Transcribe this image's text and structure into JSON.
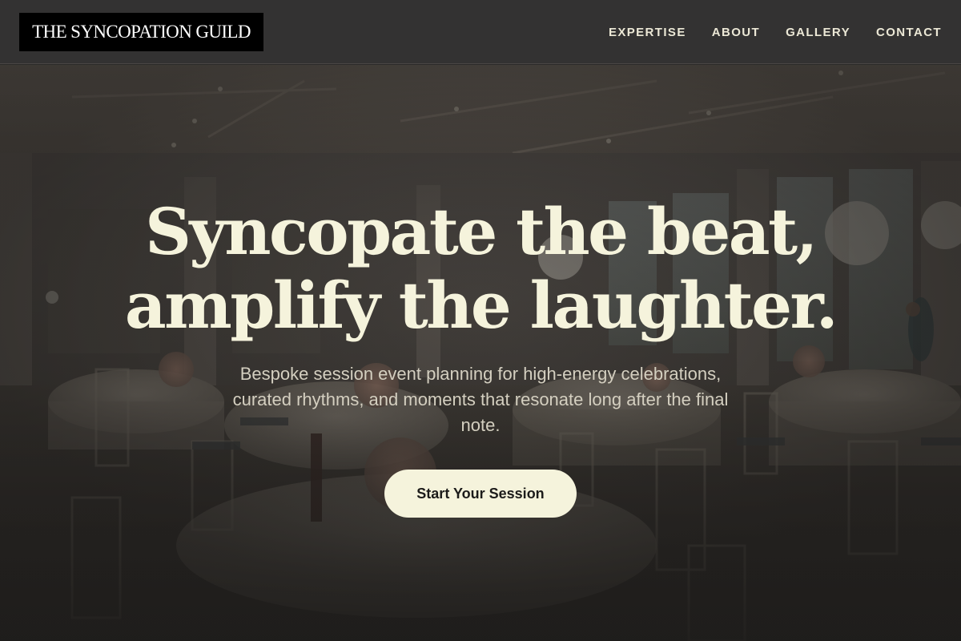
{
  "header": {
    "logo_text": "THE SYNCOPATION GUILD",
    "nav": [
      {
        "label": "EXPERTISE"
      },
      {
        "label": "ABOUT"
      },
      {
        "label": "GALLERY"
      },
      {
        "label": "CONTACT"
      }
    ]
  },
  "hero": {
    "title_line1": "Syncopate the beat,",
    "title_line2": "amplify the laughter.",
    "subtitle": "Bespoke session event planning for high-energy celebrations, curated rhythms, and moments that resonate long after the final note.",
    "cta_label": "Start Your Session"
  },
  "colors": {
    "header_bg": "#333232",
    "logo_bg": "#000000",
    "accent_cream": "#f5f3dc",
    "nav_text": "#ece8d6"
  }
}
